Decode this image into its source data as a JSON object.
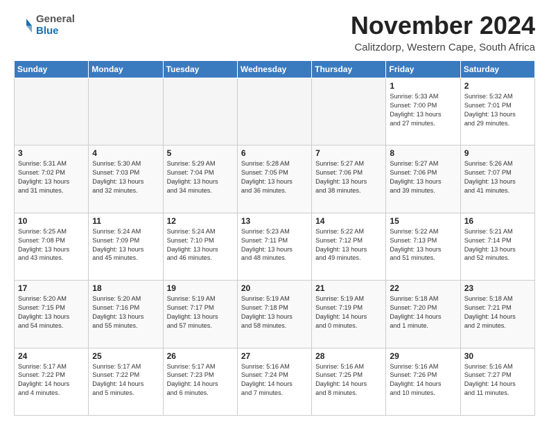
{
  "header": {
    "logo_general": "General",
    "logo_blue": "Blue",
    "month_title": "November 2024",
    "location": "Calitzdorp, Western Cape, South Africa"
  },
  "days_of_week": [
    "Sunday",
    "Monday",
    "Tuesday",
    "Wednesday",
    "Thursday",
    "Friday",
    "Saturday"
  ],
  "weeks": [
    [
      {
        "day": "",
        "info": ""
      },
      {
        "day": "",
        "info": ""
      },
      {
        "day": "",
        "info": ""
      },
      {
        "day": "",
        "info": ""
      },
      {
        "day": "",
        "info": ""
      },
      {
        "day": "1",
        "info": "Sunrise: 5:33 AM\nSunset: 7:00 PM\nDaylight: 13 hours\nand 27 minutes."
      },
      {
        "day": "2",
        "info": "Sunrise: 5:32 AM\nSunset: 7:01 PM\nDaylight: 13 hours\nand 29 minutes."
      }
    ],
    [
      {
        "day": "3",
        "info": "Sunrise: 5:31 AM\nSunset: 7:02 PM\nDaylight: 13 hours\nand 31 minutes."
      },
      {
        "day": "4",
        "info": "Sunrise: 5:30 AM\nSunset: 7:03 PM\nDaylight: 13 hours\nand 32 minutes."
      },
      {
        "day": "5",
        "info": "Sunrise: 5:29 AM\nSunset: 7:04 PM\nDaylight: 13 hours\nand 34 minutes."
      },
      {
        "day": "6",
        "info": "Sunrise: 5:28 AM\nSunset: 7:05 PM\nDaylight: 13 hours\nand 36 minutes."
      },
      {
        "day": "7",
        "info": "Sunrise: 5:27 AM\nSunset: 7:06 PM\nDaylight: 13 hours\nand 38 minutes."
      },
      {
        "day": "8",
        "info": "Sunrise: 5:27 AM\nSunset: 7:06 PM\nDaylight: 13 hours\nand 39 minutes."
      },
      {
        "day": "9",
        "info": "Sunrise: 5:26 AM\nSunset: 7:07 PM\nDaylight: 13 hours\nand 41 minutes."
      }
    ],
    [
      {
        "day": "10",
        "info": "Sunrise: 5:25 AM\nSunset: 7:08 PM\nDaylight: 13 hours\nand 43 minutes."
      },
      {
        "day": "11",
        "info": "Sunrise: 5:24 AM\nSunset: 7:09 PM\nDaylight: 13 hours\nand 45 minutes."
      },
      {
        "day": "12",
        "info": "Sunrise: 5:24 AM\nSunset: 7:10 PM\nDaylight: 13 hours\nand 46 minutes."
      },
      {
        "day": "13",
        "info": "Sunrise: 5:23 AM\nSunset: 7:11 PM\nDaylight: 13 hours\nand 48 minutes."
      },
      {
        "day": "14",
        "info": "Sunrise: 5:22 AM\nSunset: 7:12 PM\nDaylight: 13 hours\nand 49 minutes."
      },
      {
        "day": "15",
        "info": "Sunrise: 5:22 AM\nSunset: 7:13 PM\nDaylight: 13 hours\nand 51 minutes."
      },
      {
        "day": "16",
        "info": "Sunrise: 5:21 AM\nSunset: 7:14 PM\nDaylight: 13 hours\nand 52 minutes."
      }
    ],
    [
      {
        "day": "17",
        "info": "Sunrise: 5:20 AM\nSunset: 7:15 PM\nDaylight: 13 hours\nand 54 minutes."
      },
      {
        "day": "18",
        "info": "Sunrise: 5:20 AM\nSunset: 7:16 PM\nDaylight: 13 hours\nand 55 minutes."
      },
      {
        "day": "19",
        "info": "Sunrise: 5:19 AM\nSunset: 7:17 PM\nDaylight: 13 hours\nand 57 minutes."
      },
      {
        "day": "20",
        "info": "Sunrise: 5:19 AM\nSunset: 7:18 PM\nDaylight: 13 hours\nand 58 minutes."
      },
      {
        "day": "21",
        "info": "Sunrise: 5:19 AM\nSunset: 7:19 PM\nDaylight: 14 hours\nand 0 minutes."
      },
      {
        "day": "22",
        "info": "Sunrise: 5:18 AM\nSunset: 7:20 PM\nDaylight: 14 hours\nand 1 minute."
      },
      {
        "day": "23",
        "info": "Sunrise: 5:18 AM\nSunset: 7:21 PM\nDaylight: 14 hours\nand 2 minutes."
      }
    ],
    [
      {
        "day": "24",
        "info": "Sunrise: 5:17 AM\nSunset: 7:22 PM\nDaylight: 14 hours\nand 4 minutes."
      },
      {
        "day": "25",
        "info": "Sunrise: 5:17 AM\nSunset: 7:22 PM\nDaylight: 14 hours\nand 5 minutes."
      },
      {
        "day": "26",
        "info": "Sunrise: 5:17 AM\nSunset: 7:23 PM\nDaylight: 14 hours\nand 6 minutes."
      },
      {
        "day": "27",
        "info": "Sunrise: 5:16 AM\nSunset: 7:24 PM\nDaylight: 14 hours\nand 7 minutes."
      },
      {
        "day": "28",
        "info": "Sunrise: 5:16 AM\nSunset: 7:25 PM\nDaylight: 14 hours\nand 8 minutes."
      },
      {
        "day": "29",
        "info": "Sunrise: 5:16 AM\nSunset: 7:26 PM\nDaylight: 14 hours\nand 10 minutes."
      },
      {
        "day": "30",
        "info": "Sunrise: 5:16 AM\nSunset: 7:27 PM\nDaylight: 14 hours\nand 11 minutes."
      }
    ]
  ]
}
